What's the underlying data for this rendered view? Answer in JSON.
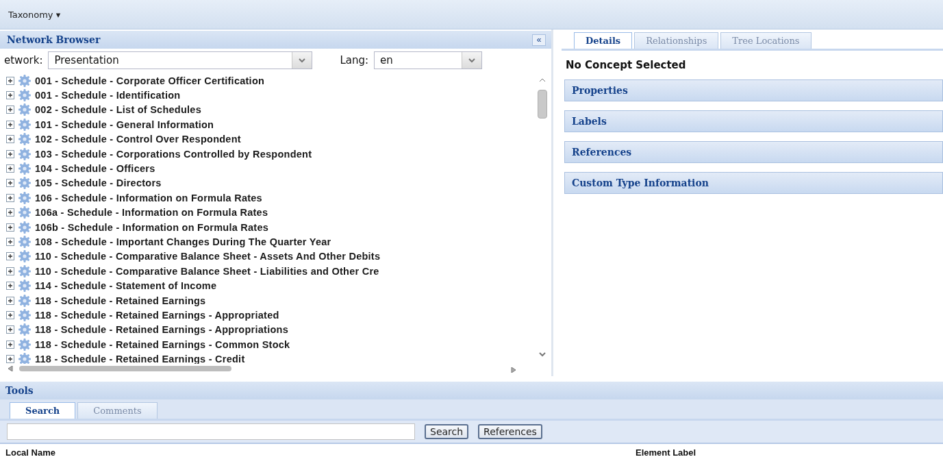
{
  "menu": {
    "label": "Taxonomy",
    "caret": "▾"
  },
  "network_browser": {
    "title": "Network Browser",
    "collapse": "«",
    "network_label": "etwork:",
    "network_value": "Presentation",
    "lang_label": "Lang:",
    "lang_value": "en",
    "tree": [
      {
        "label": "001 - Schedule - Corporate Officer Certification",
        "expanded": false
      },
      {
        "label": "001 - Schedule - Identification",
        "expanded": false
      },
      {
        "label": "002 - Schedule - List of Schedules",
        "expanded": false
      },
      {
        "label": "101 - Schedule - General Information",
        "expanded": false
      },
      {
        "label": "102 - Schedule - Control Over Respondent",
        "expanded": false
      },
      {
        "label": "103 - Schedule - Corporations Controlled by Respondent",
        "expanded": false
      },
      {
        "label": "104 - Schedule - Officers",
        "expanded": false
      },
      {
        "label": "105 - Schedule - Directors",
        "expanded": false
      },
      {
        "label": "106 - Schedule - Information on Formula Rates",
        "expanded": false
      },
      {
        "label": "106a - Schedule - Information on Formula Rates",
        "expanded": false
      },
      {
        "label": "106b - Schedule - Information on Formula Rates",
        "expanded": false
      },
      {
        "label": "108 - Schedule - Important Changes During The Quarter Year",
        "expanded": false
      },
      {
        "label": "110 - Schedule - Comparative Balance Sheet - Assets And Other Debits",
        "expanded": false
      },
      {
        "label": "110 - Schedule - Comparative Balance Sheet - Liabilities and Other Cre",
        "expanded": false
      },
      {
        "label": "114 - Schedule - Statement of Income",
        "expanded": false
      },
      {
        "label": "118 - Schedule - Retained Earnings",
        "expanded": false
      },
      {
        "label": "118 - Schedule - Retained Earnings - Appropriated",
        "expanded": false
      },
      {
        "label": "118 - Schedule - Retained Earnings - Appropriations",
        "expanded": false
      },
      {
        "label": "118 - Schedule - Retained Earnings - Common Stock",
        "expanded": false
      },
      {
        "label": "118 - Schedule - Retained Earnings - Credit",
        "expanded": false
      }
    ]
  },
  "details": {
    "tabs": [
      {
        "label": "Details",
        "selected": true
      },
      {
        "label": "Relationships",
        "selected": false
      },
      {
        "label": "Tree Locations",
        "selected": false
      }
    ],
    "heading": "No Concept Selected",
    "sections": [
      {
        "title": "Properties",
        "expanded": false
      },
      {
        "title": "Labels",
        "expanded": false
      },
      {
        "title": "References",
        "expanded": false
      },
      {
        "title": "Custom Type Information",
        "expanded": false
      }
    ]
  },
  "tools": {
    "title": "Tools",
    "tabs": [
      {
        "label": "Search",
        "selected": true
      },
      {
        "label": "Comments",
        "selected": false
      }
    ],
    "buttons": [
      "Search",
      "References"
    ],
    "columns": [
      "Local Name",
      "Element Label"
    ]
  }
}
